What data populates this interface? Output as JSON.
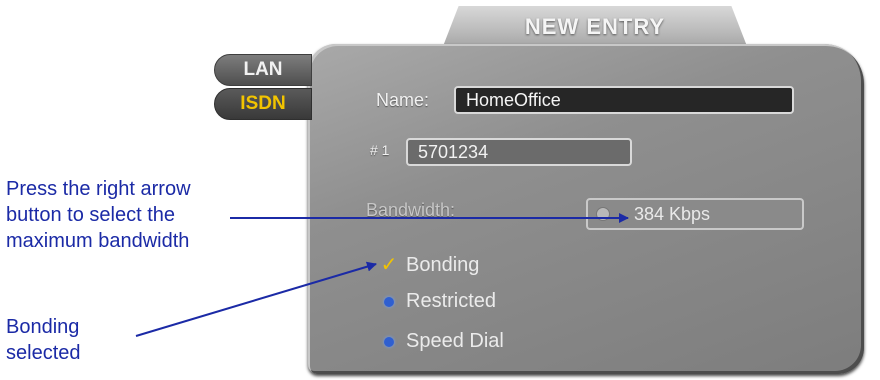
{
  "callouts": {
    "bandwidth": [
      "Press the right arrow",
      "button to select the",
      "maximum bandwidth"
    ],
    "bonding": [
      "Bonding",
      "selected"
    ]
  },
  "panel": {
    "title": "NEW ENTRY",
    "tabs": [
      {
        "label": "LAN",
        "active": false
      },
      {
        "label": "ISDN",
        "active": true
      }
    ],
    "name_label": "Name:",
    "name_value": "HomeOffice",
    "number_label": "# 1",
    "number_value": "5701234",
    "bandwidth_label": "Bandwidth:",
    "bandwidth_value": "384  Kbps",
    "options": [
      {
        "label": "Bonding",
        "icon": "check-icon",
        "checked": true
      },
      {
        "label": "Restricted",
        "icon": "blue-dot-icon",
        "checked": false
      },
      {
        "label": "Speed Dial",
        "icon": "blue-dot-icon",
        "checked": false
      }
    ]
  },
  "colors": {
    "callout_text": "#1b2aa6",
    "leader_line": "#1b2aa6",
    "active_tab_text": "#f2c400",
    "check": "#f2c400",
    "option_dot": "#2f5fd0"
  }
}
